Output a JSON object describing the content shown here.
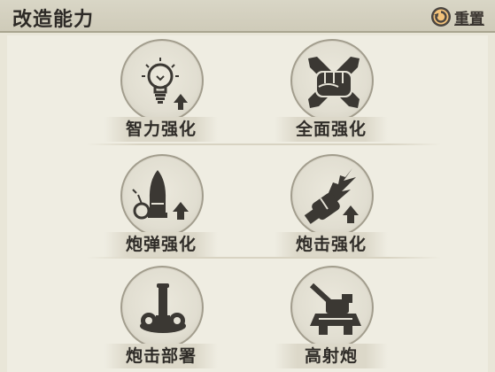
{
  "header": {
    "title": "改造能力",
    "reset_label": "重置"
  },
  "skills": [
    {
      "label": "智力强化",
      "icon": "lightbulb-upgrade-icon"
    },
    {
      "label": "全面强化",
      "icon": "fist-crossed-icon"
    },
    {
      "label": "炮弹强化",
      "icon": "shell-upgrade-icon"
    },
    {
      "label": "炮击强化",
      "icon": "fist-blast-upgrade-icon"
    },
    {
      "label": "炮击部署",
      "icon": "cannon-deploy-icon"
    },
    {
      "label": "高射炮",
      "icon": "anti-air-gun-icon"
    }
  ],
  "colors": {
    "background": "#e9e6d8",
    "icon": "#3b3833",
    "header_bar": "#d4d0bf"
  }
}
